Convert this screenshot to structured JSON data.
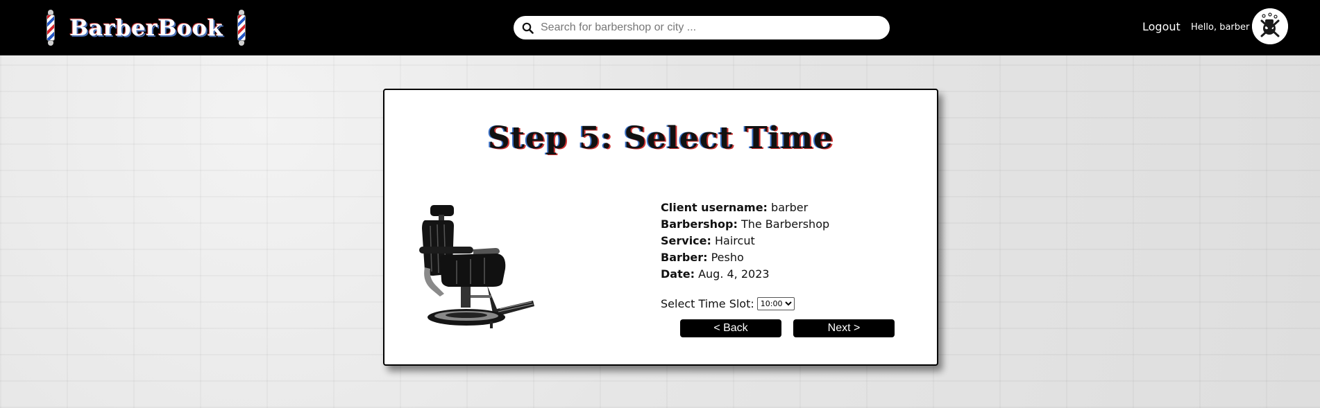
{
  "header": {
    "brand": "BarberBook",
    "search": {
      "placeholder": "Search for barbershop or city ...",
      "value": ""
    },
    "logout_label": "Logout",
    "greeting": "Hello, barber"
  },
  "booking": {
    "title": "Step 5: Select Time",
    "details": [
      {
        "label": "Client username:",
        "value": "barber"
      },
      {
        "label": "Barbershop:",
        "value": "The Barbershop"
      },
      {
        "label": "Service:",
        "value": "Haircut"
      },
      {
        "label": "Barber:",
        "value": "Pesho"
      },
      {
        "label": "Date:",
        "value": "Aug. 4, 2023"
      }
    ],
    "time_slot_label": "Select Time Slot:",
    "time_slot_selected": "10:00",
    "back_label": "< Back",
    "next_label": "Next >"
  },
  "colors": {
    "header_bg": "#000000",
    "button_bg": "#000000",
    "pole_red": "#d8232a",
    "pole_blue": "#2457c5"
  }
}
